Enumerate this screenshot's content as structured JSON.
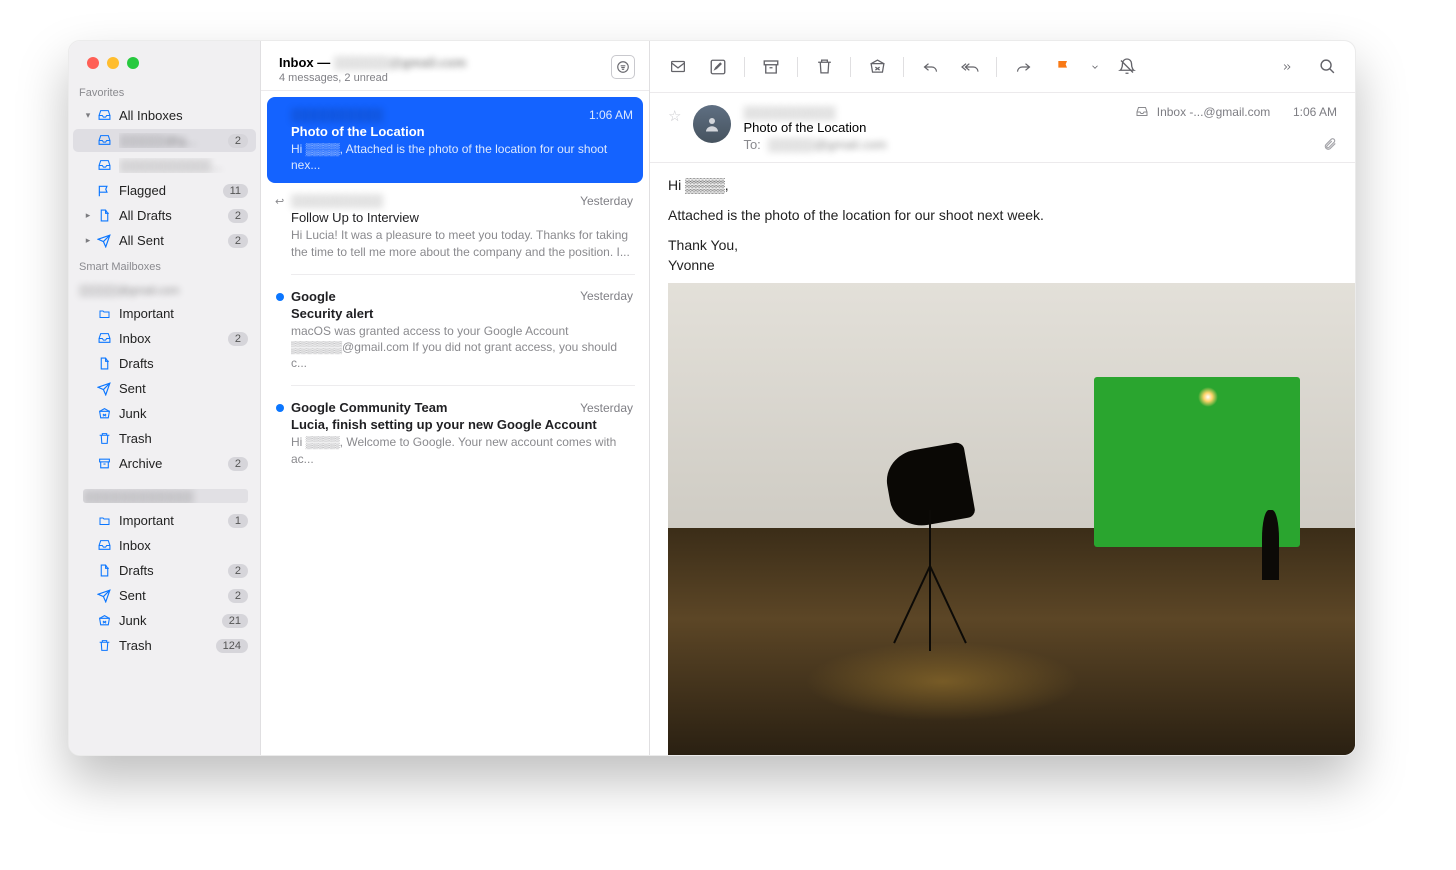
{
  "sidebar": {
    "favorites_label": "Favorites",
    "all_inboxes": "All Inboxes",
    "account1": "▒▒▒▒▒@g...",
    "account1_badge": "2",
    "account2": "▒▒▒▒▒▒▒▒▒▒...",
    "flagged": "Flagged",
    "flagged_badge": "11",
    "all_drafts": "All Drafts",
    "all_drafts_badge": "2",
    "all_sent": "All Sent",
    "all_sent_badge": "2",
    "smart_label": "Smart Mailboxes",
    "acctA": "▒▒▒▒▒@gmail.com",
    "a_important": "Important",
    "a_inbox": "Inbox",
    "a_inbox_badge": "2",
    "a_drafts": "Drafts",
    "a_sent": "Sent",
    "a_junk": "Junk",
    "a_trash": "Trash",
    "a_archive": "Archive",
    "a_archive_badge": "2",
    "acctB": "▒▒▒▒▒▒▒▒▒▒▒▒",
    "b_important": "Important",
    "b_important_badge": "1",
    "b_inbox": "Inbox",
    "b_drafts": "Drafts",
    "b_drafts_badge": "2",
    "b_sent": "Sent",
    "b_sent_badge": "2",
    "b_junk": "Junk",
    "b_junk_badge": "21",
    "b_trash": "Trash",
    "b_trash_badge": "124"
  },
  "list": {
    "title_prefix": "Inbox — ",
    "title_account": "▒▒▒▒▒▒@gmail.com",
    "subtitle": "4 messages, 2 unread"
  },
  "messages": [
    {
      "from": "▒▒▒▒▒▒▒▒▒▒",
      "time": "1:06 AM",
      "subject": "Photo of the Location",
      "preview": "Hi ▒▒▒▒, Attached is the photo of the location for our shoot nex...",
      "unread": false,
      "selected": true,
      "replied": false
    },
    {
      "from": "▒▒▒▒▒▒▒▒▒▒",
      "time": "Yesterday",
      "subject": "Follow Up to Interview",
      "preview": "Hi Lucia! It was a pleasure to meet you today. Thanks for taking the time to tell me more about the company and the position. I...",
      "unread": false,
      "selected": false,
      "replied": true
    },
    {
      "from": "Google",
      "time": "Yesterday",
      "subject": "Security alert",
      "preview": "macOS was granted access to your Google Account ▒▒▒▒▒▒@gmail.com If you did not grant access, you should c...",
      "unread": true,
      "selected": false,
      "replied": false
    },
    {
      "from": "Google Community Team",
      "time": "Yesterday",
      "subject": "Lucia, finish setting up your new Google Account",
      "preview": "Hi ▒▒▒▒, Welcome to Google. Your new account comes with ac...",
      "unread": true,
      "selected": false,
      "replied": false
    }
  ],
  "detail": {
    "from": "▒▒▒▒▒▒▒▒▒▒",
    "subject": "Photo of the Location",
    "to_label": "To:",
    "to_value": "▒▒▒▒▒@gmail.com",
    "mailbox_crumb": "Inbox -...@gmail.com",
    "time": "1:06 AM",
    "body_line1": "Hi ▒▒▒▒,",
    "body_line2": "Attached is the photo of the location for our shoot next week.",
    "body_line3": "Thank You,",
    "body_line4": "Yvonne"
  }
}
